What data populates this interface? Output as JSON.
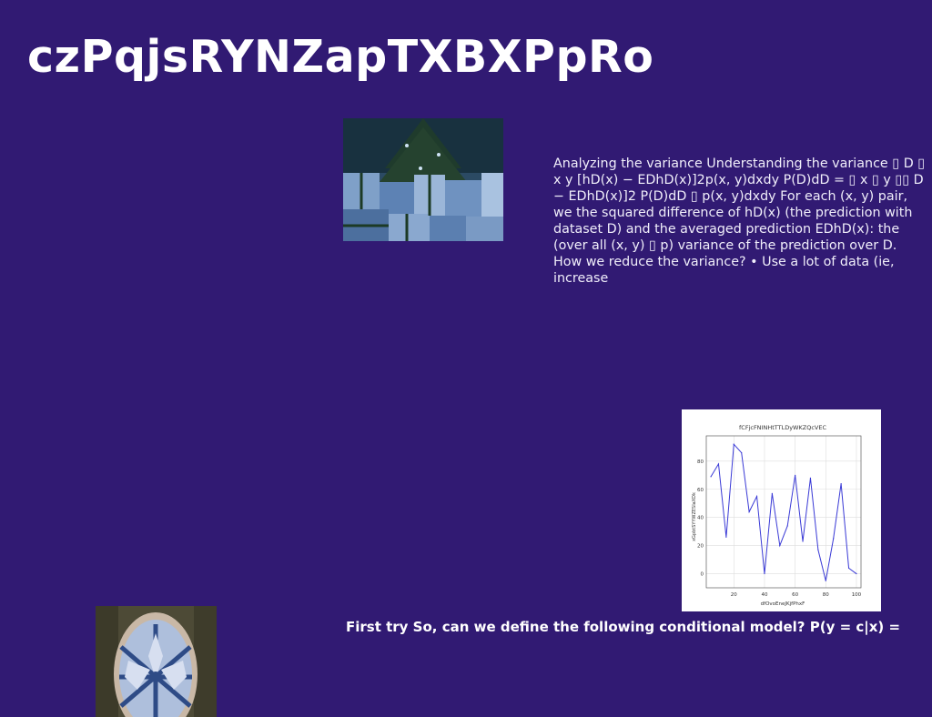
{
  "title": "czPqjsRYNZapTXBXPpRo",
  "body_text": "Analyzing the variance Understanding the variance ▯ D ▯ x y [hD(x) − EDhD(x)]2p(x, y)dxdy P(D)dD = ▯ x ▯ y ▯▯ D − EDhD(x)]2 P(D)dD ▯ p(x, y)dxdy For each (x, y) pair, we the squared difference of hD(x) (the prediction with dataset D) and the averaged prediction EDhD(x): the (over all (x, y) ▯ p) variance of the prediction over D. How we reduce the variance? • Use a lot of data (ie, increase",
  "bottom_text": "First try So, can we define the following conditional model? P(y = c|x) =",
  "images": {
    "gifts_photo": "christmas-gifts-photo",
    "ornament_photo": "snowflake-ornament-photo"
  },
  "chart_data": {
    "type": "line",
    "title": "fCFjcFNINHtTTLDyWKZQcVEC",
    "xlabel": "dfOvoEneJKjfPhxF",
    "ylabel": "xGpbtSYYWZESIaXDk",
    "x": [
      5,
      10,
      15,
      20,
      25,
      30,
      35,
      40,
      45,
      50,
      55,
      60,
      65,
      70,
      75,
      80,
      85,
      90,
      95,
      100
    ],
    "series": [
      {
        "values": [
          69,
          78,
          26,
          92,
          86,
          44,
          55,
          0,
          57,
          20,
          34,
          70,
          23,
          68,
          17,
          -5,
          25,
          64,
          4,
          0
        ]
      }
    ],
    "xlim": [
      2,
      103
    ],
    "ylim": [
      -10,
      98
    ],
    "xticks": [
      20,
      40,
      60,
      80,
      100
    ],
    "yticks": [
      0,
      20,
      40,
      60,
      80
    ],
    "grid": true,
    "line_color": "#3a3ad6"
  }
}
